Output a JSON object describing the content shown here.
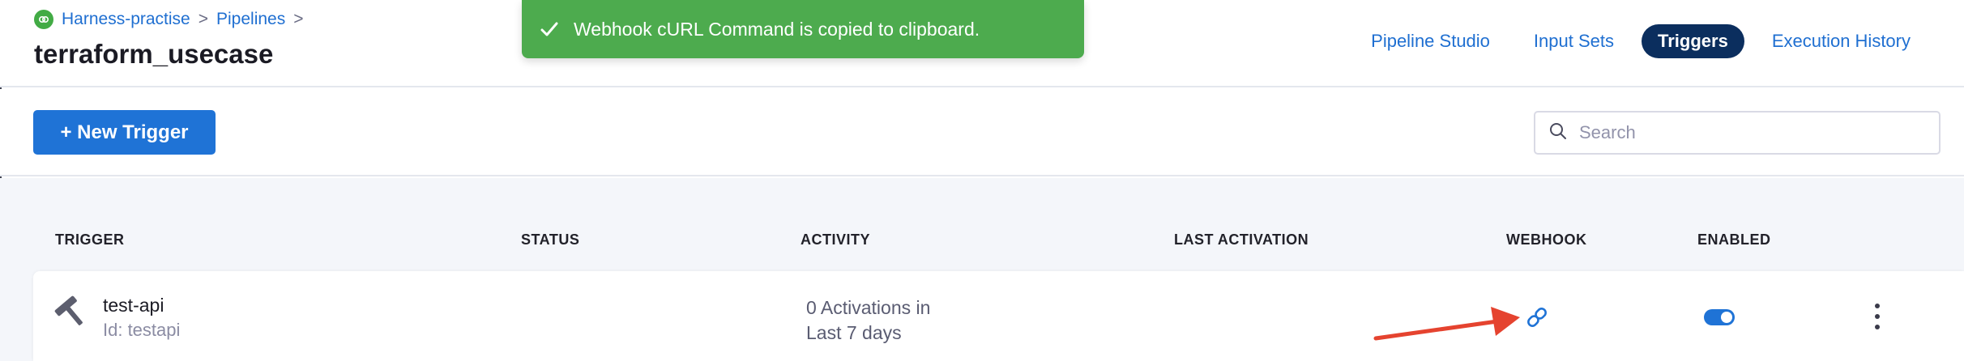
{
  "breadcrumb": {
    "project": "Harness-practise",
    "separator": ">",
    "section": "Pipelines"
  },
  "header": {
    "title": "terraform_usecase"
  },
  "nav": {
    "tabs": [
      {
        "label": "Pipeline Studio",
        "active": false
      },
      {
        "label": "Input Sets",
        "active": false
      },
      {
        "label": "Triggers",
        "active": true
      },
      {
        "label": "Execution History",
        "active": false
      }
    ]
  },
  "toast": {
    "message": "Webhook cURL Command is copied to clipboard.",
    "icon": "check-icon"
  },
  "toolbar": {
    "new_trigger_label": "+ New Trigger",
    "search": {
      "placeholder": "Search",
      "value": ""
    }
  },
  "table": {
    "columns": [
      "TRIGGER",
      "STATUS",
      "ACTIVITY",
      "LAST ACTIVATION",
      "WEBHOOK",
      "ENABLED"
    ],
    "rows": [
      {
        "name": "test-api",
        "id_text": "Id: testapi",
        "status": "",
        "activity_line1": "0 Activations in",
        "activity_line2": "Last 7 days",
        "last_activation": "",
        "webhook_icon": "link-icon",
        "enabled": true,
        "trigger_icon": "hammer-icon"
      }
    ]
  },
  "colors": {
    "primary": "#1f73d6",
    "active_tab": "#0b2e5e",
    "toast": "#4dab4e",
    "annotation_arrow": "#e5432f"
  }
}
